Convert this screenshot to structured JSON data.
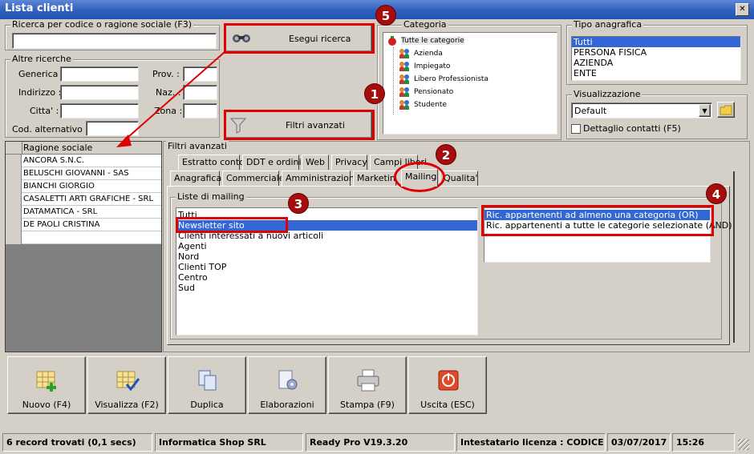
{
  "window": {
    "title": "Lista clienti",
    "close": "✕"
  },
  "search": {
    "group_title": "Ricerca per codice o ragione sociale (F3)",
    "value": "",
    "run_button": "Esegui ricerca",
    "filter_button": "Filtri avanzati"
  },
  "other_search": {
    "group_title": "Altre ricerche",
    "generica": "Generica :",
    "indirizzo": "Indirizzo :",
    "citta": "Citta' :",
    "prov": "Prov. :",
    "naz": "Naz. :",
    "zona": "Zona :",
    "cod_alt": "Cod. alternativo :"
  },
  "categoria": {
    "group_title": "Categoria",
    "root": "Tutte le categorie",
    "items": [
      "Azienda",
      "Impiegato",
      "Libero Professionista",
      "Pensionato",
      "Studente"
    ]
  },
  "tipo": {
    "group_title": "Tipo anagrafica",
    "items": [
      "Tutti",
      "PERSONA FISICA",
      "AZIENDA",
      "ENTE"
    ],
    "selected": 0
  },
  "visualizzazione": {
    "group_title": "Visualizzazione",
    "value": "Default",
    "checkbox": "Dettaglio contatti (F5)"
  },
  "grid": {
    "header": "Ragione sociale",
    "rows": [
      "ANCORA S.N.C.",
      "BELUSCHI GIOVANNI - SAS",
      "BIANCHI GIORGIO",
      "CASALETTI ARTI GRAFICHE - SRL",
      "DATAMATICA - SRL",
      "DE PAOLI CRISTINA"
    ]
  },
  "filters": {
    "title": "Filtri avanzati",
    "tabs_row1": [
      "Estratto conto",
      "DDT e ordini",
      "Web",
      "Privacy",
      "Campi liberi"
    ],
    "tabs_row2": [
      "Anagrafica",
      "Commerciale",
      "Amministrazione",
      "Marketing",
      "Mailing",
      "Qualita'"
    ],
    "active_tab": "Mailing",
    "lists_title": "Liste di mailing",
    "lists": [
      "Tutti",
      "Newsletter sito",
      "Clienti interessati a nuovi articoli",
      "Agenti",
      "Nord",
      "Clienti TOP",
      "Centro",
      "Sud"
    ],
    "lists_selected": 1,
    "modes": [
      "Ric. appartenenti ad almeno una categoria (OR)",
      "Ric. appartenenti a tutte le categorie selezionate (AND)"
    ],
    "modes_selected": 0
  },
  "badges": [
    "1",
    "2",
    "3",
    "4",
    "5"
  ],
  "buttons": [
    "Nuovo (F4)",
    "Visualizza (F2)",
    "Duplica",
    "Elaborazioni",
    "Stampa (F9)",
    "Uscita (ESC)"
  ],
  "status": {
    "records": "6 record trovati (0,1 secs)",
    "company": "Informatica Shop SRL",
    "version": "Ready Pro V19.3.20",
    "license": "Intestatario licenza : CODICE SRL",
    "date": "03/07/2017",
    "time": "15:26"
  },
  "colors": {
    "annotation_red": "#e00000",
    "badge": "#a60d0d",
    "selection": "#3367d6",
    "titlebar": "#2f5fbd"
  }
}
